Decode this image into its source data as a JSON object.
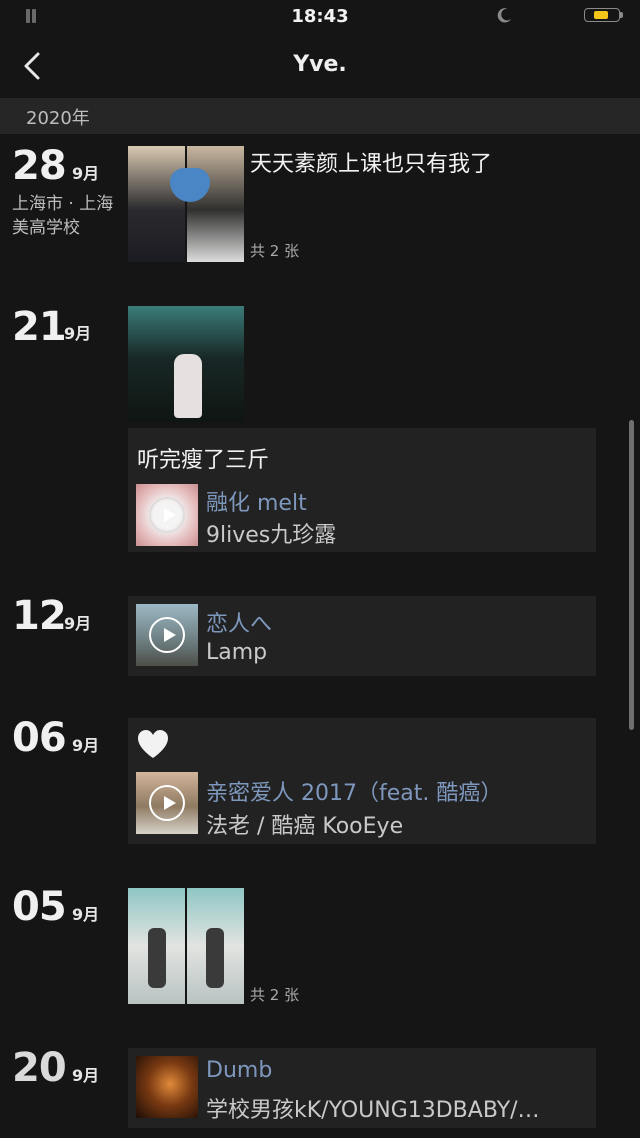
{
  "status": {
    "time": "18:43"
  },
  "header": {
    "title": "Yve."
  },
  "year": "2020年",
  "posts": [
    {
      "day": "28",
      "month": "9月",
      "location": "上海市 · 上海美高学校",
      "text": "天天素颜上课也只有我了",
      "count": "共 2 张"
    },
    {
      "day": "21",
      "month": "9月",
      "text": "听完瘦了三斤",
      "music": {
        "title": "融化 melt",
        "artist": "9lives九珍露"
      }
    },
    {
      "day": "12",
      "month": "9月",
      "music": {
        "title": "恋人へ",
        "artist": "Lamp"
      }
    },
    {
      "day": "06",
      "month": "9月",
      "music": {
        "title": "亲密爱人 2017（feat. 酷癌）",
        "artist": "法老 / 酷癌 KooEye"
      }
    },
    {
      "day": "05",
      "month": "9月",
      "count": "共 2 张"
    },
    {
      "day": "20",
      "month": "9月",
      "music": {
        "title": "Dumb",
        "artist": "学校男孩kK/YOUNG13DBABY/…"
      }
    }
  ],
  "icons": {
    "back": "chevron-left-icon",
    "moon": "moon-icon",
    "battery": "battery-icon",
    "heart": "heart-icon",
    "play": "play-icon"
  },
  "colors": {
    "background": "#151515",
    "link": "#7e97bd",
    "card": "#222222",
    "battery": "#f3c51b"
  }
}
